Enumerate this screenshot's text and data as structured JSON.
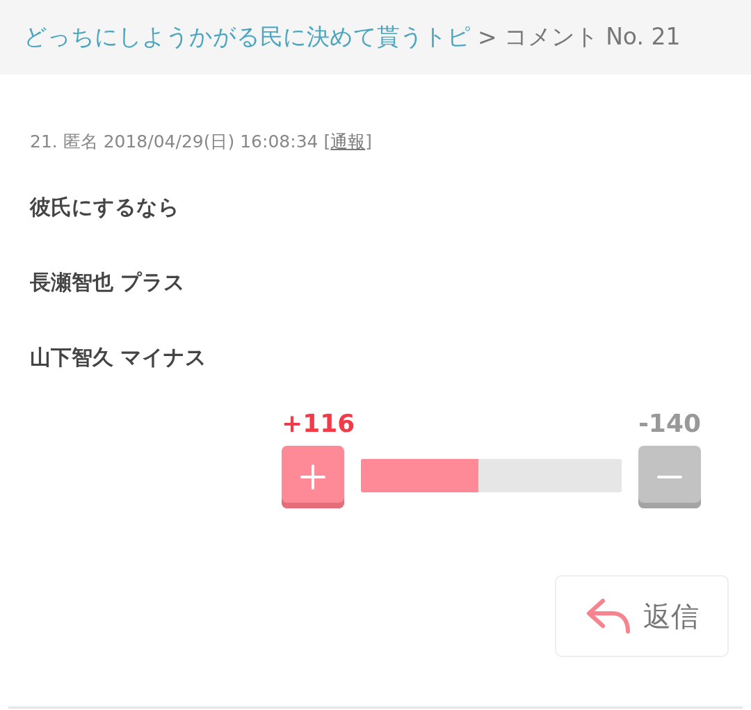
{
  "breadcrumb": {
    "link": "どっちにしようかがる民に決めて貰うトピ",
    "separator": ">",
    "current": "コメント No. 21"
  },
  "comment": {
    "meta": "21. 匿名 2018/04/29(日) 16:08:34",
    "report_open": "[",
    "report_link": "通報",
    "report_close": "]",
    "lines": [
      "彼氏にするなら",
      "長瀬智也 プラス",
      "山下智久 マイナス"
    ]
  },
  "vote": {
    "plus": "+116",
    "minus": "-140",
    "level": 0.45
  },
  "reply": {
    "label": "返信"
  }
}
